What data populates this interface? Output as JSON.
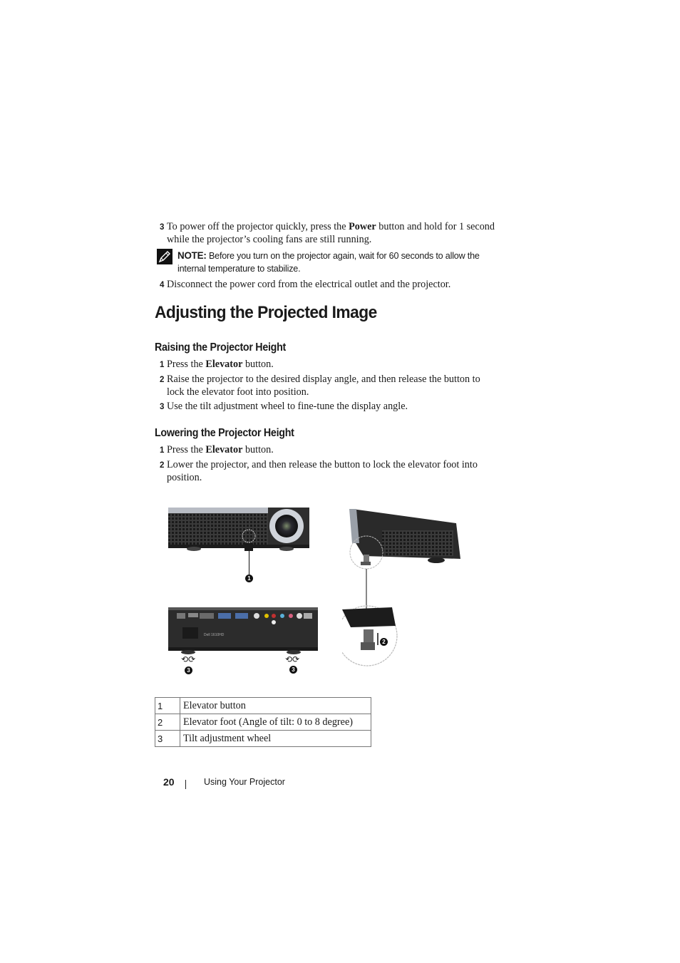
{
  "steps_top": [
    {
      "num": "3",
      "pre": "To power off the projector quickly, press the ",
      "bold": "Power",
      "post": " button and hold for 1 second",
      "line2": "while the projector’s cooling fans are still running."
    },
    {
      "num": "4",
      "text": "Disconnect the power cord from the electrical outlet and the projector."
    }
  ],
  "note": {
    "icon": "pencil-note-icon",
    "label": "NOTE:",
    "text": " Before you turn on the projector again, wait for 60 seconds to allow the",
    "line2": "internal temperature to stabilize."
  },
  "heading": "Adjusting the Projected Image",
  "raising": {
    "title": "Raising the Projector Height",
    "steps": [
      {
        "num": "1",
        "pre": "Press the ",
        "bold": "Elevator",
        "post": " button."
      },
      {
        "num": "2",
        "text": "Raise the projector to the desired display angle, and then release the button to",
        "line2": "lock the elevator foot into position."
      },
      {
        "num": "3",
        "text": "Use the tilt adjustment wheel to fine-tune the display angle."
      }
    ]
  },
  "lowering": {
    "title": "Lowering the Projector Height",
    "steps": [
      {
        "num": "1",
        "pre": "Press the ",
        "bold": "Elevator",
        "post": " button."
      },
      {
        "num": "2",
        "text": "Lower the projector, and then release the button to lock the elevator foot into",
        "line2": "position."
      }
    ]
  },
  "figure": {
    "callouts": [
      "1",
      "2",
      "3",
      "3"
    ],
    "model_label": "Dell 1610HD"
  },
  "legend": [
    {
      "num": "1",
      "desc": "Elevator button"
    },
    {
      "num": "2",
      "desc": "Elevator foot (Angle of tilt: 0 to 8 degree)"
    },
    {
      "num": "3",
      "desc": "Tilt adjustment wheel"
    }
  ],
  "footer": {
    "page": "20",
    "section": "Using Your Projector"
  }
}
